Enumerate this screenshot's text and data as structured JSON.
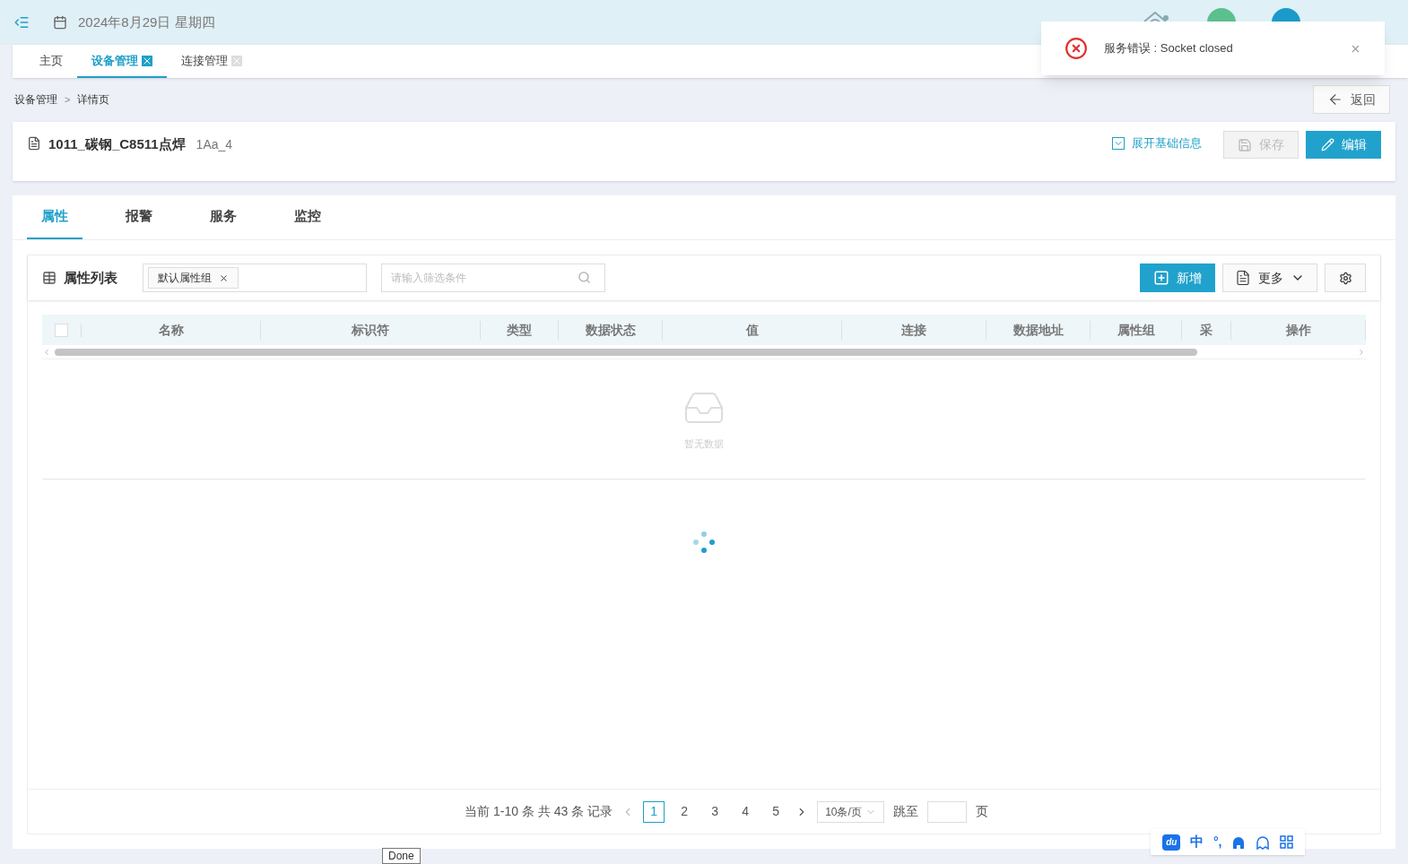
{
  "header": {
    "date": "2024年8月29日 星期四"
  },
  "page_tabs": [
    {
      "label": "主页",
      "selected": false,
      "closable": false
    },
    {
      "label": "设备管理",
      "selected": true,
      "closable": true
    },
    {
      "label": "连接管理",
      "selected": false,
      "closable": true
    }
  ],
  "breadcrumb": [
    "设备管理",
    "详情页"
  ],
  "breadcrumb_separator": ">",
  "back_button": "返回",
  "device": {
    "name": "1011_碳钢_C8511点焊",
    "code": "1Aa_4",
    "expand_link": "展开基础信息",
    "save_button": {
      "label": "保存",
      "disabled": true
    },
    "edit_button": "编辑"
  },
  "detail_tabs": [
    {
      "label": "属性",
      "selected": true
    },
    {
      "label": "报警",
      "selected": false
    },
    {
      "label": "服务",
      "selected": false
    },
    {
      "label": "监控",
      "selected": false
    }
  ],
  "list": {
    "title": "属性列表",
    "group_tag": "默认属性组",
    "filter_placeholder": "请输入筛选条件",
    "add_button": "新增",
    "more_button": "更多"
  },
  "table": {
    "select_all_checked": false,
    "columns": [
      "名称",
      "标识符",
      "类型",
      "数据状态",
      "值",
      "连接",
      "数据地址",
      "属性组",
      "采",
      "操作"
    ],
    "empty_text": "暂无数据"
  },
  "pagination": {
    "summary": "当前 1-10 条 共 43 条 记录",
    "pages": [
      {
        "label": "1",
        "selected": true
      },
      {
        "label": "2",
        "selected": false
      },
      {
        "label": "3",
        "selected": false
      },
      {
        "label": "4",
        "selected": false
      },
      {
        "label": "5",
        "selected": false
      }
    ],
    "page_size": "10条/页",
    "jump_label": "跳至",
    "page_unit": "页"
  },
  "toast": {
    "message": "服务错误 : Socket closed"
  },
  "tooltip": "Done",
  "ime_toolbar": {
    "logo": "du",
    "mode": "中",
    "punctuation": "°,"
  }
}
